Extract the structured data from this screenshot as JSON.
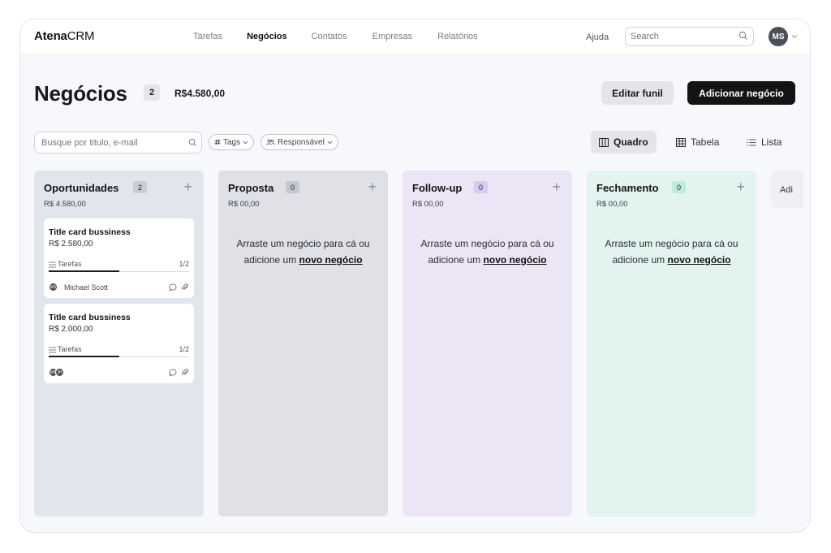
{
  "app": {
    "brand_bold": "Atena",
    "brand_light": "CRM"
  },
  "nav": {
    "items": [
      {
        "label": "Tarefas",
        "active": false
      },
      {
        "label": "Negócios",
        "active": true
      },
      {
        "label": "Contatos",
        "active": false
      },
      {
        "label": "Empresas",
        "active": false
      },
      {
        "label": "Relatórios",
        "active": false
      }
    ],
    "help": "Ajuda",
    "search_placeholder": "Search",
    "user_initials": "MS"
  },
  "header": {
    "title": "Negócios",
    "count": "2",
    "total": "R$4.580,00",
    "edit_button": "Editar funil",
    "add_button": "Adicionar negócio"
  },
  "filters": {
    "search_placeholder": "Busque por titulo, e-mail",
    "tags_chip": "Tags",
    "responsible_chip": "Responsável"
  },
  "views": {
    "board": "Quadro",
    "table": "Tabela",
    "list": "Lista",
    "active": "board"
  },
  "columns": [
    {
      "title": "Oportunidades",
      "count": "2",
      "amount": "R$ 4.580,00",
      "bg": "#e1e6ec",
      "badge_bg": "#c7ced8",
      "cards": [
        {
          "title": "Title card bussiness",
          "amount": "R$ 2.580,00",
          "task_label": "Tarefas",
          "task_count": "1/2",
          "progress": 0.5,
          "owner": "Michael Scott",
          "avatars": [
            "MS"
          ]
        },
        {
          "title": "Title card bussiness",
          "amount": "R$ 2.000,00",
          "task_label": "Tarefas",
          "task_count": "1/2",
          "progress": 0.5,
          "owner": "",
          "avatars": [
            "MS",
            "JH"
          ]
        }
      ]
    },
    {
      "title": "Proposta",
      "count": "0",
      "amount": "R$ 00,00",
      "bg": "#dfe1e6",
      "badge_bg": "#c4c7cf",
      "empty_text": "Arraste um negócio para cá ou adicione um",
      "empty_link": "novo negócio"
    },
    {
      "title": "Follow-up",
      "count": "0",
      "amount": "R$ 00,00",
      "bg": "#ebe5f5",
      "badge_bg": "#d8c9f0",
      "empty_text": "Arraste um negócio para cá ou adicione um",
      "empty_link": "novo negócio"
    },
    {
      "title": "Fechamento",
      "count": "0",
      "amount": "R$ 00,00",
      "bg": "#e3f3ef",
      "badge_bg": "#c0eadb",
      "empty_text": "Arraste um negócio para cá ou adicione um",
      "empty_link": "novo negócio"
    }
  ],
  "add_column_label": "Adi",
  "colors": {
    "accent_dark": "#141414",
    "frame_bg": "#f6f8fb"
  }
}
